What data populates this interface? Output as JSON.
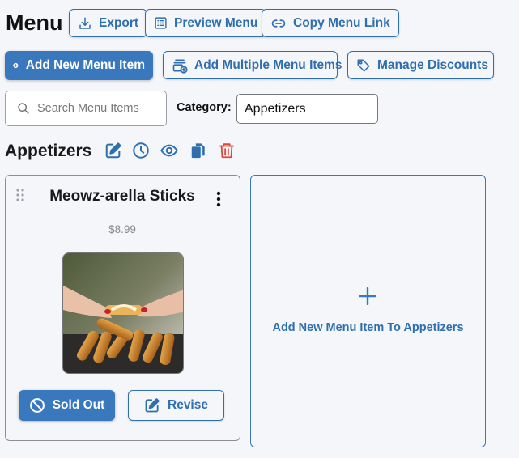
{
  "header": {
    "title": "Menu",
    "export_label": "Export",
    "preview_label": "Preview Menu",
    "copy_link_label": "Copy Menu Link"
  },
  "toolbar": {
    "add_item_label": "Add New Menu Item",
    "add_multiple_label": "Add Multiple Menu Items",
    "discounts_label": "Manage Discounts"
  },
  "filters": {
    "search_placeholder": "Search Menu Items",
    "category_label": "Category:",
    "category_value": "Appetizers"
  },
  "section": {
    "title": "Appetizers",
    "icons": [
      "edit-icon",
      "clock-icon",
      "eye-icon",
      "copy-icon",
      "trash-icon"
    ]
  },
  "items": [
    {
      "name": "Meowz-arella Sticks",
      "price": "$8.99",
      "sold_out_label": "Sold Out",
      "revise_label": "Revise"
    }
  ],
  "add_card": {
    "label": "Add New Menu Item To Appetizers"
  },
  "colors": {
    "primary": "#3a78bd",
    "outline": "#2f6fb0",
    "danger": "#e0453a",
    "background": "#f4f6f9"
  }
}
